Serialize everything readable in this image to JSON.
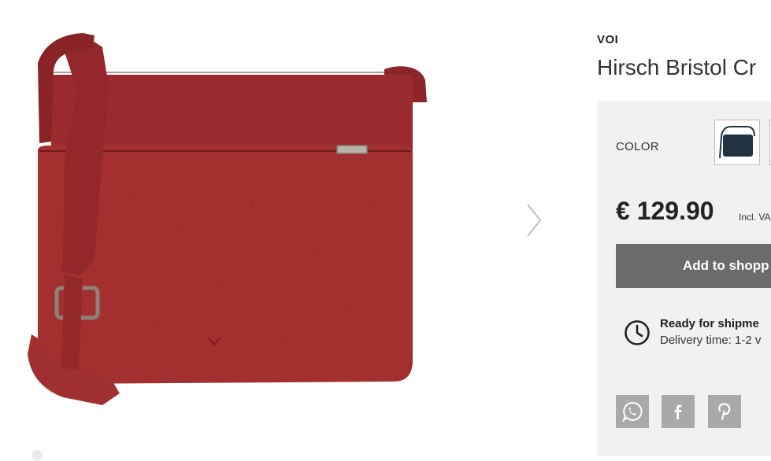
{
  "product": {
    "brand": "VOI",
    "title": "Hirsch Bristol Cr",
    "color_label": "COLOR",
    "price": "€ 129.90",
    "vat_note": "Incl. VA",
    "add_to_cart_label": "Add to shopp",
    "shipping_title": "Ready for shipme",
    "shipping_subtitle": "Delivery time: 1-2 v"
  },
  "gallery": {
    "image_subject": "red leather crossbody bag",
    "bag_color": "#9b2b2e",
    "next_icon": "chevron-right-icon"
  },
  "swatches": [
    {
      "name": "dark-navy",
      "color": "#1f3340"
    }
  ],
  "social": [
    {
      "name": "whatsapp",
      "icon": "whatsapp-icon"
    },
    {
      "name": "facebook",
      "icon": "facebook-icon"
    },
    {
      "name": "pinterest",
      "icon": "pinterest-icon"
    }
  ],
  "colors": {
    "panel_bg": "#f1f1f1",
    "button_bg": "#6b6b6b",
    "social_bg": "#a9a9a9"
  }
}
